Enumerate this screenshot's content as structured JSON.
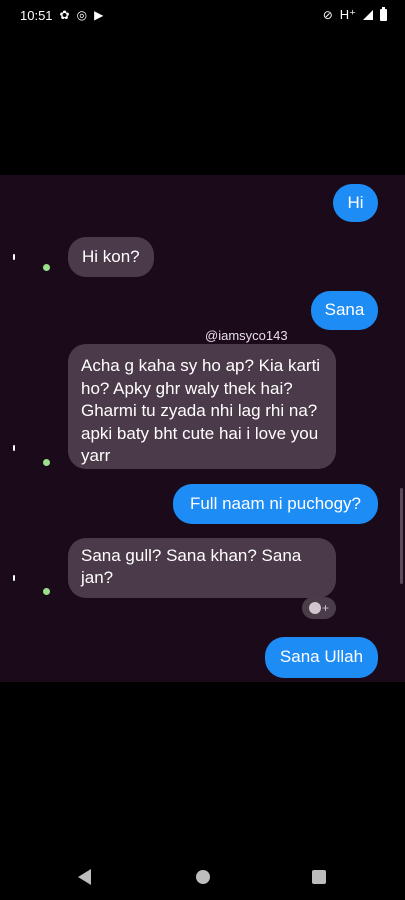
{
  "status_bar": {
    "time": "10:51",
    "network": "H⁺",
    "left_icons": [
      "settings-icon",
      "whatsapp-icon",
      "play-store-icon"
    ],
    "right_icons": [
      "mute-icon",
      "signal-icon",
      "battery-icon"
    ]
  },
  "chat": {
    "watermark": "@iamsyco143",
    "messages": [
      {
        "direction": "outgoing",
        "text": "Hi"
      },
      {
        "direction": "incoming",
        "text": "Hi kon?"
      },
      {
        "direction": "outgoing",
        "text": "Sana"
      },
      {
        "direction": "incoming",
        "text": "Acha g kaha sy ho ap? Kia karti ho? Apky ghr waly thek hai? Gharmi tu zyada nhi lag rhi na?apki baty bht cute hai i love you yarr"
      },
      {
        "direction": "outgoing",
        "text": "Full naam ni puchogy?"
      },
      {
        "direction": "incoming",
        "text": "Sana gull? Sana khan? Sana jan?"
      },
      {
        "direction": "outgoing",
        "text": "Sana Ullah"
      }
    ],
    "reaction_symbol": "+",
    "colors": {
      "outgoing_bubble": "#1e8cf5",
      "incoming_bubble": "#4b3a49",
      "chat_background": "#1b0a1a"
    }
  },
  "nav_bar": {
    "buttons": [
      "back-icon",
      "home-icon",
      "recents-icon"
    ]
  }
}
